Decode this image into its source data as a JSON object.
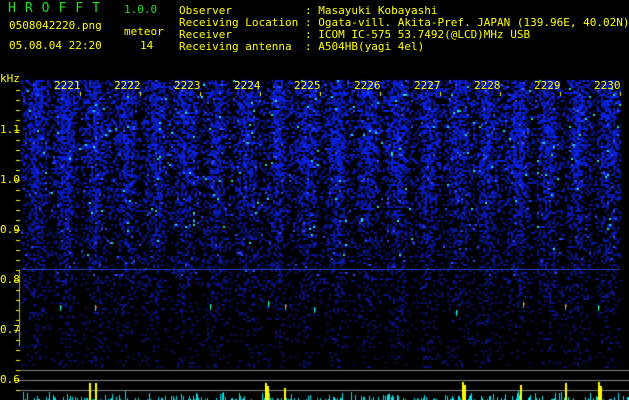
{
  "app": {
    "title": "HROFFT",
    "version": "1.0.0"
  },
  "file": {
    "name": "0508042220.png",
    "datetime": "05.08.04 22:20"
  },
  "meteor": {
    "label": "meteor",
    "count": "14"
  },
  "info": [
    {
      "label": "Observer",
      "value": ": Masayuki Kobayashi"
    },
    {
      "label": "Receiving Location",
      "value": ": Ogata-vill. Akita-Pref. JAPAN (139.96E, 40.02N)"
    },
    {
      "label": "Receiver",
      "value": ": ICOM IC-575 53.7492(@LCD)MHz USB"
    },
    {
      "label": "Receiving antenna",
      "value": ": A504HB(yagi 4el)"
    }
  ],
  "spectrogram": {
    "y_unit": "kHz",
    "y_ticks": [
      "1.1",
      "1.0",
      "0.9",
      "0.8",
      "0.7",
      "0.6"
    ],
    "time_labels": [
      "2221",
      "2222",
      "2223",
      "2224",
      "2225",
      "2226",
      "2227",
      "2228",
      "2229",
      "2230"
    ],
    "colors": {
      "text": "#ffff00",
      "title": "#22dd22",
      "noise": "#1e2fd0",
      "echo": "#00ffff",
      "histogram": "#00e5ee",
      "spike": "#ffff00"
    }
  }
}
